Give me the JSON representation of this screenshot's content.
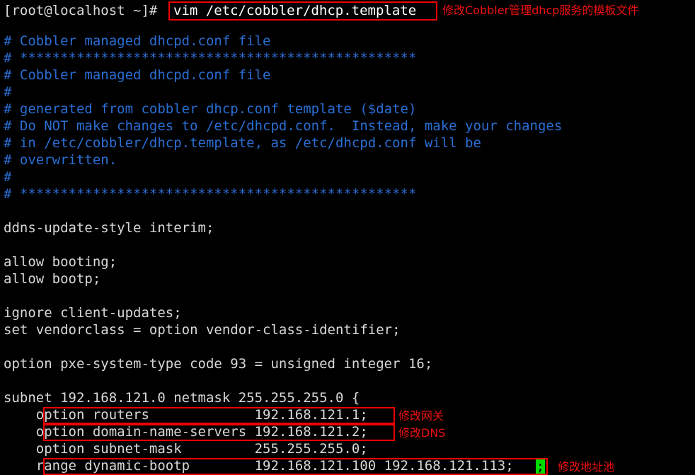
{
  "terminal": {
    "prompt": "[root@localhost ~]# ",
    "command": "vim /etc/cobbler/dhcp.template",
    "command_annotation": "修改Cobbler管理dhcp服务的模板文件",
    "background_color": "#000000",
    "foreground_color": "#d8d8d8",
    "comment_color": "#2a6ed4",
    "annotation_color": "#ee1111",
    "highlight_box_color": "#ee0000",
    "cursor_color": "#00dd00"
  },
  "file": {
    "path": "/etc/cobbler/dhcp.template",
    "lines": [
      "# Cobbler managed dhcpd.conf file",
      "# *************************************************",
      "# Cobbler managed dhcpd.conf file",
      "#",
      "# generated from cobbler dhcp.conf template ($date)",
      "# Do NOT make changes to /etc/dhcpd.conf.  Instead, make your changes",
      "# in /etc/cobbler/dhcp.template, as /etc/dhcpd.conf will be",
      "# overwritten.",
      "#",
      "# *************************************************",
      "",
      "ddns-update-style interim;",
      "",
      "allow booting;",
      "allow bootp;",
      "",
      "ignore client-updates;",
      "set vendorclass = option vendor-class-identifier;",
      "",
      "option pxe-system-type code 93 = unsigned integer 16;",
      "",
      "subnet 192.168.121.0 netmask 255.255.255.0 {",
      "    option routers             192.168.121.1;",
      "    option domain-name-servers 192.168.121.2;",
      "    option subnet-mask         255.255.255.0;",
      "    range dynamic-bootp        192.168.121.100 192.168.121.113;"
    ]
  },
  "annotations": [
    {
      "id": "command",
      "label": "修改Cobbler管理dhcp服务的模板文件"
    },
    {
      "id": "routers",
      "label": "修改网关"
    },
    {
      "id": "dns",
      "label": "修改DNS"
    },
    {
      "id": "range",
      "label": "修改地址池"
    }
  ],
  "cursor": {
    "character": ";"
  }
}
